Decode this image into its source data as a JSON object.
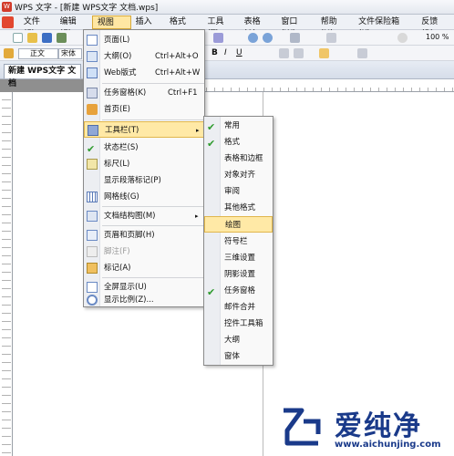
{
  "window": {
    "title": "WPS 文字 - [新建 WPS文字 文档.wps]"
  },
  "menubar": {
    "items": [
      "文件(F)",
      "编辑(E)",
      "视图(V)",
      "插入(I)",
      "格式(O)",
      "工具(T)",
      "表格(A)",
      "窗口(W)",
      "帮助(H)",
      "文件保险箱(K)"
    ],
    "feedback": "反馈(B)"
  },
  "toolbar": {
    "zoom": "100 %",
    "style": "正文",
    "font": "宋体"
  },
  "doc_tab": {
    "label": "新建 WPS文字 文档"
  },
  "view_menu": {
    "items": [
      {
        "label": "页面(L)",
        "shortcut": "",
        "icon": "page-icon"
      },
      {
        "label": "大纲(O)",
        "shortcut": "Ctrl+Alt+O",
        "icon": "outline-icon"
      },
      {
        "label": "Web版式",
        "shortcut": "Ctrl+Alt+W",
        "icon": "web-layout-icon"
      },
      {
        "label": "任务窗格(K)",
        "shortcut": "Ctrl+F1",
        "icon": "task-pane-icon"
      },
      {
        "label": "首页(E)",
        "shortcut": "",
        "icon": "home-icon"
      },
      {
        "label": "工具栏(T)",
        "shortcut": "",
        "icon": "toolbar-icon",
        "submenu": true,
        "highlighted": true
      },
      {
        "label": "状态栏(S)",
        "shortcut": "",
        "icon": "check-icon",
        "checked": true
      },
      {
        "label": "标尺(L)",
        "shortcut": "",
        "icon": "ruler-icon"
      },
      {
        "label": "显示段落标记(P)",
        "shortcut": "",
        "icon": ""
      },
      {
        "label": "网格线(G)",
        "shortcut": "",
        "icon": "gridlines-icon"
      },
      {
        "label": "文档结构图(M)",
        "shortcut": "",
        "icon": "doc-map-icon",
        "submenu": true
      },
      {
        "label": "页眉和页脚(H)",
        "shortcut": "",
        "icon": "header-footer-icon"
      },
      {
        "label": "脚注(F)",
        "shortcut": "",
        "icon": "footnote-icon",
        "disabled": true
      },
      {
        "label": "标记(A)",
        "shortcut": "",
        "icon": "markup-icon"
      },
      {
        "label": "全屏显示(U)",
        "shortcut": "",
        "icon": "fullscreen-icon"
      },
      {
        "label": "显示比例(Z)...",
        "shortcut": "",
        "icon": "zoom-icon"
      }
    ]
  },
  "toolbar_submenu": {
    "items": [
      {
        "label": "常用",
        "checked": true
      },
      {
        "label": "格式",
        "checked": true
      },
      {
        "label": "表格和边框",
        "checked": false
      },
      {
        "label": "对象对齐",
        "checked": false
      },
      {
        "label": "审阅",
        "checked": false
      },
      {
        "label": "其他格式",
        "checked": false
      },
      {
        "label": "绘图",
        "checked": false,
        "highlighted": true
      },
      {
        "label": "符号栏",
        "checked": false
      },
      {
        "label": "三维设置",
        "checked": false
      },
      {
        "label": "阴影设置",
        "checked": false
      },
      {
        "label": "任务窗格",
        "checked": true
      },
      {
        "label": "邮件合并",
        "checked": false
      },
      {
        "label": "控件工具箱",
        "checked": false
      },
      {
        "label": "大纲",
        "checked": false
      },
      {
        "label": "窗体",
        "checked": false
      }
    ]
  },
  "watermark": {
    "brand": "爱纯净",
    "url": "www.aichunjing.com"
  },
  "colors": {
    "highlight": "#ffe9a6",
    "check": "#2f9b2f",
    "brand": "#1a3a8a"
  }
}
